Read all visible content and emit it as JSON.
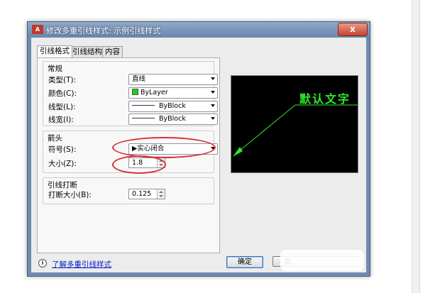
{
  "window": {
    "app_icon_text": "A",
    "title": "修改多重引线样式: 示例引线样式",
    "close_label": "x"
  },
  "tabs": [
    {
      "label": "引线格式",
      "active": true
    },
    {
      "label": "引线结构",
      "active": false
    },
    {
      "label": "内容",
      "active": false
    }
  ],
  "general": {
    "title": "常规",
    "type_label": "类型(T):",
    "type_value": "直线",
    "color_label": "颜色(C):",
    "color_value": "ByLayer",
    "color_swatch": "#16d316",
    "linetype_label": "线型(L):",
    "linetype_value": "ByBlock",
    "lineweight_label": "线宽(I):",
    "lineweight_value": "ByBlock"
  },
  "arrowhead": {
    "title": "箭头",
    "symbol_label": "符号(S):",
    "symbol_value": "实心闭合",
    "size_label": "大小(Z):",
    "size_value": "1.8"
  },
  "landing_break": {
    "title": "引线打断",
    "break_size_label": "打断大小(B):",
    "break_size_value": "0.125"
  },
  "preview": {
    "text": "默认文字",
    "color": "#2ee62e"
  },
  "footer": {
    "help_link": "了解多重引线样式",
    "ok_label": "确定",
    "cancel_label": "取"
  },
  "highlight_color": "#d9313a"
}
